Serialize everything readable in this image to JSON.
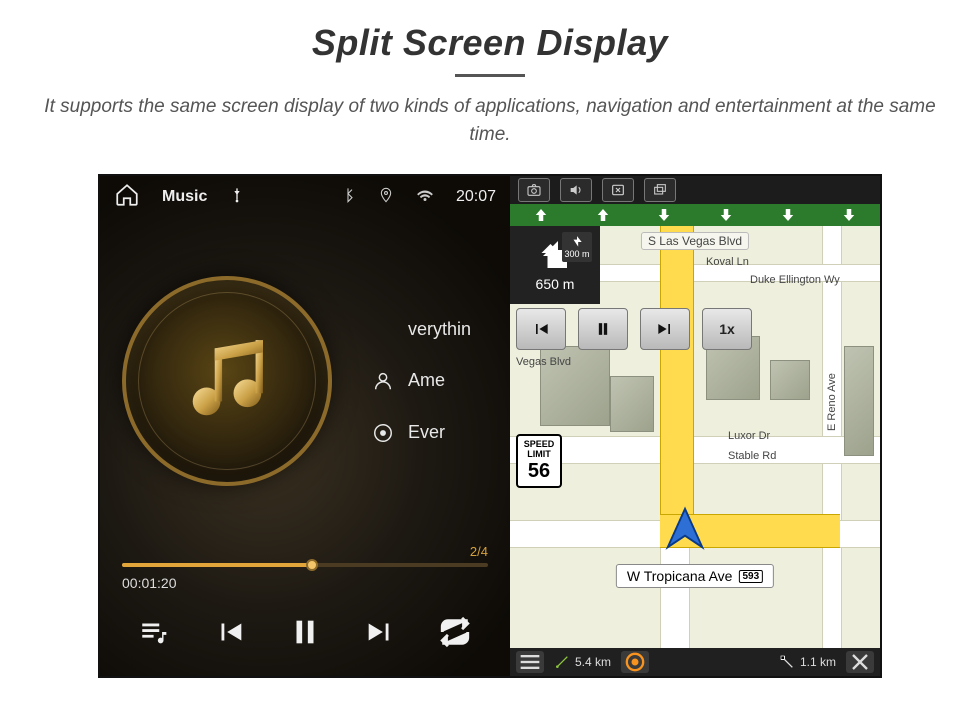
{
  "header": {
    "title": "Split Screen Display",
    "subtitle": "It supports the same screen display of two kinds of applications, navigation and entertainment at the same time."
  },
  "music": {
    "topbar_label": "Music",
    "song_title_visible": "verythin",
    "artist_visible": "Ame",
    "album_visible": "Ever",
    "track_counter": "2/4",
    "elapsed": "00:01:20"
  },
  "statusbar": {
    "time": "20:07"
  },
  "nav": {
    "top_road": "S Las Vegas Blvd",
    "turn_next_distance": "300 m",
    "turn_distance": "650 m",
    "speed_rate": "1x",
    "speed_limit_label1": "SPEED",
    "speed_limit_label2": "LIMIT",
    "speed_limit_value": "56",
    "current_street": "W Tropicana Ave",
    "route_shield": "593",
    "labels": {
      "koval": "Koval Ln",
      "duke": "Duke Ellington Wy",
      "luxor": "Luxor Dr",
      "stable": "Stable Rd",
      "reno": "E Reno Ave",
      "vegas_blvd": "Vegas Blvd"
    },
    "bottom": {
      "dist_done": "5.4 km",
      "dist_remain": "1.1 km"
    }
  }
}
